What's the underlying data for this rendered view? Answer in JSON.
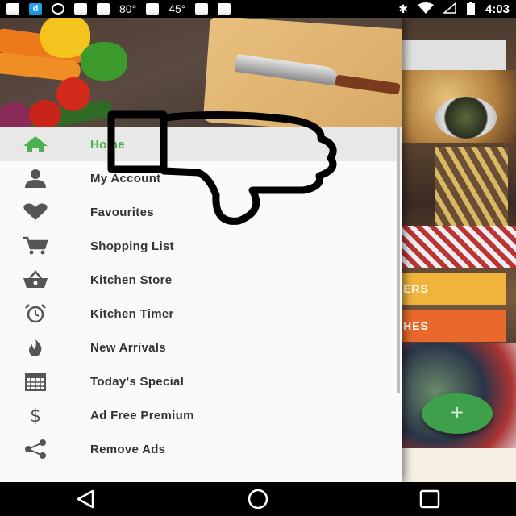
{
  "status_bar": {
    "icons_left": [
      "message-icon",
      "d-app-icon",
      "alert-icon",
      "no-gps-icon",
      "lock-icon"
    ],
    "weather_temp": "80°",
    "android_temp": "45°",
    "time": "4:03",
    "d_label": "d"
  },
  "drawer": {
    "menu": [
      {
        "label": "Home",
        "icon": "home-icon",
        "active": true
      },
      {
        "label": "My Account",
        "icon": "person-icon",
        "active": false
      },
      {
        "label": "Favourites",
        "icon": "heart-icon",
        "active": false
      },
      {
        "label": "Shopping List",
        "icon": "cart-icon",
        "active": false
      },
      {
        "label": "Kitchen Store",
        "icon": "basket-icon",
        "active": false
      },
      {
        "label": "Kitchen Timer",
        "icon": "alarm-clock-icon",
        "active": false
      },
      {
        "label": "New Arrivals",
        "icon": "flame-icon",
        "active": false
      },
      {
        "label": "Today's Special",
        "icon": "calendar-icon",
        "active": false
      },
      {
        "label": "Ad Free Premium",
        "icon": "dollar-icon",
        "active": false
      },
      {
        "label": "Remove Ads",
        "icon": "share-icon",
        "active": false
      }
    ]
  },
  "background_app": {
    "button1_label": "ERS",
    "button2_label": "HES",
    "fab_label": "+"
  },
  "colors": {
    "accent": "#4caf50",
    "fab": "#3ea04a",
    "button1": "#f0b43c",
    "button2": "#e8692b"
  }
}
